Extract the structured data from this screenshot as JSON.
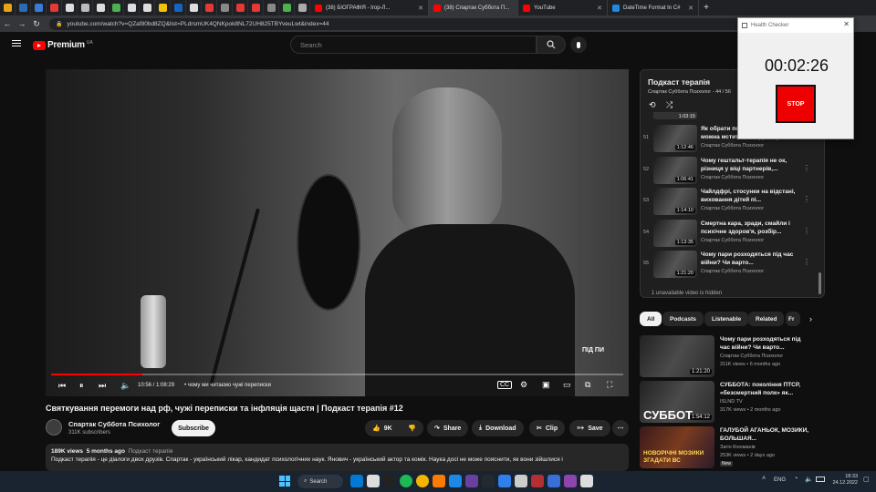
{
  "browser": {
    "tabs": [
      {
        "label": "(38) БІОГРАФІЯ - Ігор-Л...",
        "color": "#ff0000"
      },
      {
        "label": "(38) Спартак Суббота П...",
        "color": "#ff0000",
        "active": true
      },
      {
        "label": "YouTube",
        "color": "#ff0000"
      },
      {
        "label": "DateTime Format In C#",
        "color": "#1e88e5"
      }
    ],
    "pinned_tab_colors": [
      "#e8a317",
      "#2b6cb0",
      "#3a7bd5",
      "#e53935",
      "#ddd",
      "#bbb",
      "#ddd",
      "#4caf50",
      "#ddd",
      "#ddd",
      "#f4c20d",
      "#1565c0",
      "#ddd",
      "#e53935",
      "#888",
      "#e53935",
      "#e53935",
      "#888",
      "#4caf50",
      "#aaa"
    ],
    "url": "youtube.com/watch?v=QZaf80bd8ZQ&list=PLdrsmUK4QNKpok8NL72UH825TBYveuLwt&index=44"
  },
  "youtube": {
    "logo_text": "Premium",
    "logo_region": "UA",
    "search_placeholder": "Search",
    "player": {
      "time": "10:56 / 1:08:29",
      "chapter": "• чому ми читаємо чужі переписки",
      "progress_fraction": 0.16,
      "watermark": "ПІД ПИ"
    },
    "video_title": "Святкування перемоги над рф, чужі переписки та інфляція щастя | Подкаст терапія #12",
    "channel_name": "Спартак Суббота Психолог",
    "subscribers": "311K subscribers",
    "subscribe_label": "Subscribe",
    "likes": "9K",
    "share_label": "Share",
    "download_label": "Download",
    "clip_label": "Clip",
    "save_label": "Save",
    "description": {
      "views": "189K views",
      "age": "5 months ago",
      "tag": "Подкаст терапія",
      "text": "Подкаст терапія - це діалоги двох друзів. Спартак - український лікар, кандидат психологічних наук. Янович - український актор та комік. Наука досі не може пояснити, як вони зійшлися і"
    },
    "playlist": {
      "title": "Подкаст терапія",
      "subtitle": "Спартак Суббота Психолог - 44 / 56",
      "partial_top_duration": "1:03:15",
      "items": [
        {
          "index": "51",
          "title": "Як обрати психолога? Чи можна мститися людям? |...",
          "channel": "Спартак Суббота Психолог",
          "duration": "1:12:46"
        },
        {
          "index": "52",
          "title": "Чому гештальт-терапія не ок, різниця у віці партнерів,...",
          "channel": "Спартак Суббота Психолог",
          "duration": "1:06:41"
        },
        {
          "index": "53",
          "title": "Чайлдфрі, стосунки на відстані, виховання дітей пі...",
          "channel": "Спартак Суббота Психолог",
          "duration": "1:14:10"
        },
        {
          "index": "54",
          "title": "Смертна кара, зради, смайли і психічне здоров'я, розбір...",
          "channel": "Спартак Суббота Психолог",
          "duration": "1:13:35"
        },
        {
          "index": "55",
          "title": "Чому пари розходяться під час війни? Чи варто...",
          "channel": "Спартак Суббота Психолог",
          "duration": "1:21:20"
        }
      ],
      "unavailable_note": "1 unavailable video is hidden"
    },
    "chips": [
      "All",
      "Podcasts",
      "Listenable",
      "Related",
      "Fr"
    ],
    "recommendations": [
      {
        "title": "Чому пари розходяться під час війни? Чи варто...",
        "channel": "Спартак Суббота Психолог",
        "views": "311K views • 6 months ago",
        "duration": "1:21:20"
      },
      {
        "title": "СУББОТА: покоління ПТСР, «безсмертний полк» як...",
        "channel": "ISLND TV",
        "views": "317K views • 2 months ago",
        "duration": "1:54:12",
        "thumb_text": "СУББОТ"
      },
      {
        "title": "ГАЛУБОЙ АГАНЬОК, МОЗИКИ, БОЛЬШАЯ...",
        "channel": "Загін Кіноманів",
        "views": "253K views • 2 days ago",
        "badge": "New",
        "duration": "",
        "thumb_text": "НОВОРІЧНІ МОЗИКИ ЗГАДАТИ ВС"
      }
    ]
  },
  "health_checker": {
    "title": "Health Checker",
    "time": "00:02:26",
    "stop_label": "STOP"
  },
  "taskbar": {
    "search_label": "Search",
    "language": "ENG",
    "time": "18:33",
    "date": "24.12.2022",
    "app_colors": [
      "#0078d4",
      "#ddd",
      "#222",
      "#1db954",
      "#f4b400",
      "#ff7a00",
      "#1e88e5",
      "#6b3fa0",
      "#24292f",
      "#2f80ed",
      "#ccc",
      "#b52e31",
      "#3a6fd8",
      "#8e44ad",
      "#ddd"
    ]
  }
}
